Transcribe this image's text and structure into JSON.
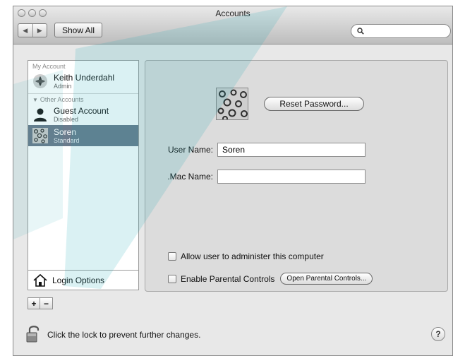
{
  "window": {
    "title": "Accounts"
  },
  "toolbar": {
    "back_icon": "chevron-left-icon",
    "forward_icon": "chevron-right-icon",
    "show_all_label": "Show All",
    "search_icon": "search-icon",
    "search_value": ""
  },
  "sidebar": {
    "my_account_header": "My Account",
    "my_account": {
      "name": "Keith Underdahl",
      "role": "Admin"
    },
    "other_accounts_header": "Other Accounts",
    "other_accounts": [
      {
        "name": "Guest Account",
        "role": "Disabled"
      },
      {
        "name": "Soren",
        "role": "Standard"
      }
    ],
    "login_options_label": "Login Options",
    "add_label": "+",
    "remove_label": "−"
  },
  "panel": {
    "reset_password_label": "Reset Password...",
    "user_name_label": "User Name:",
    "user_name_value": "Soren",
    "mac_name_label": ".Mac Name:",
    "mac_name_value": "",
    "allow_admin_label": "Allow user to administer this computer",
    "allow_admin_checked": false,
    "parental_controls_label": "Enable Parental Controls",
    "parental_controls_checked": false,
    "open_parental_controls_label": "Open Parental Controls..."
  },
  "footer": {
    "lock_text": "Click the lock to prevent further changes.",
    "help_label": "?"
  },
  "colors": {
    "selection": "#6b7b8c",
    "watermark": "#1aa7b4"
  }
}
